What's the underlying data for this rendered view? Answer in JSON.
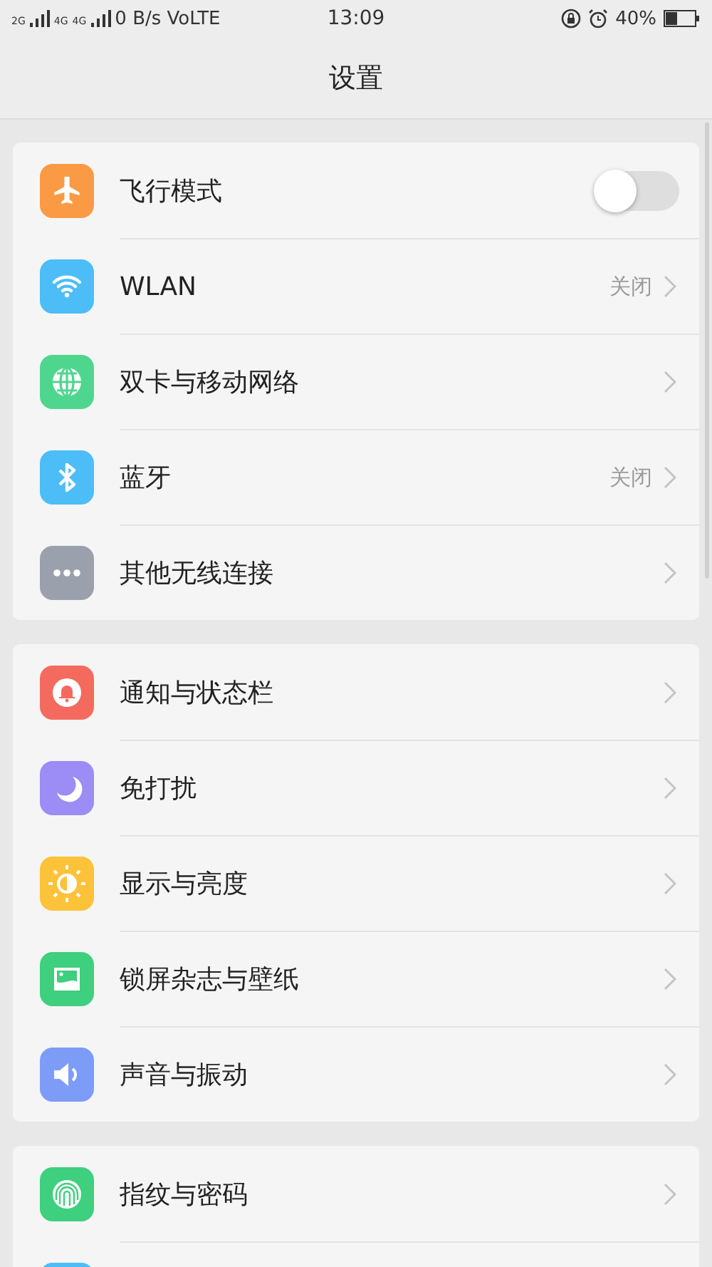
{
  "status_bar": {
    "sim1": "2G",
    "sim2_a": "4G",
    "sim2_b": "4G",
    "speed": "0 B/s VoLTE",
    "time": "13:09",
    "battery": "40%"
  },
  "header": {
    "title": "设置"
  },
  "groups": [
    {
      "items": [
        {
          "kind": "toggle",
          "label": "飞行模式",
          "on": false
        },
        {
          "kind": "link",
          "label": "WLAN",
          "value": "关闭"
        },
        {
          "kind": "link",
          "label": "双卡与移动网络"
        },
        {
          "kind": "link",
          "label": "蓝牙",
          "value": "关闭"
        },
        {
          "kind": "link",
          "label": "其他无线连接"
        }
      ]
    },
    {
      "items": [
        {
          "kind": "link",
          "label": "通知与状态栏"
        },
        {
          "kind": "link",
          "label": "免打扰"
        },
        {
          "kind": "link",
          "label": "显示与亮度"
        },
        {
          "kind": "link",
          "label": "锁屏杂志与壁纸"
        },
        {
          "kind": "link",
          "label": "声音与振动"
        }
      ]
    },
    {
      "items": [
        {
          "kind": "link",
          "label": "指纹与密码"
        },
        {
          "kind": "cut"
        }
      ]
    }
  ]
}
